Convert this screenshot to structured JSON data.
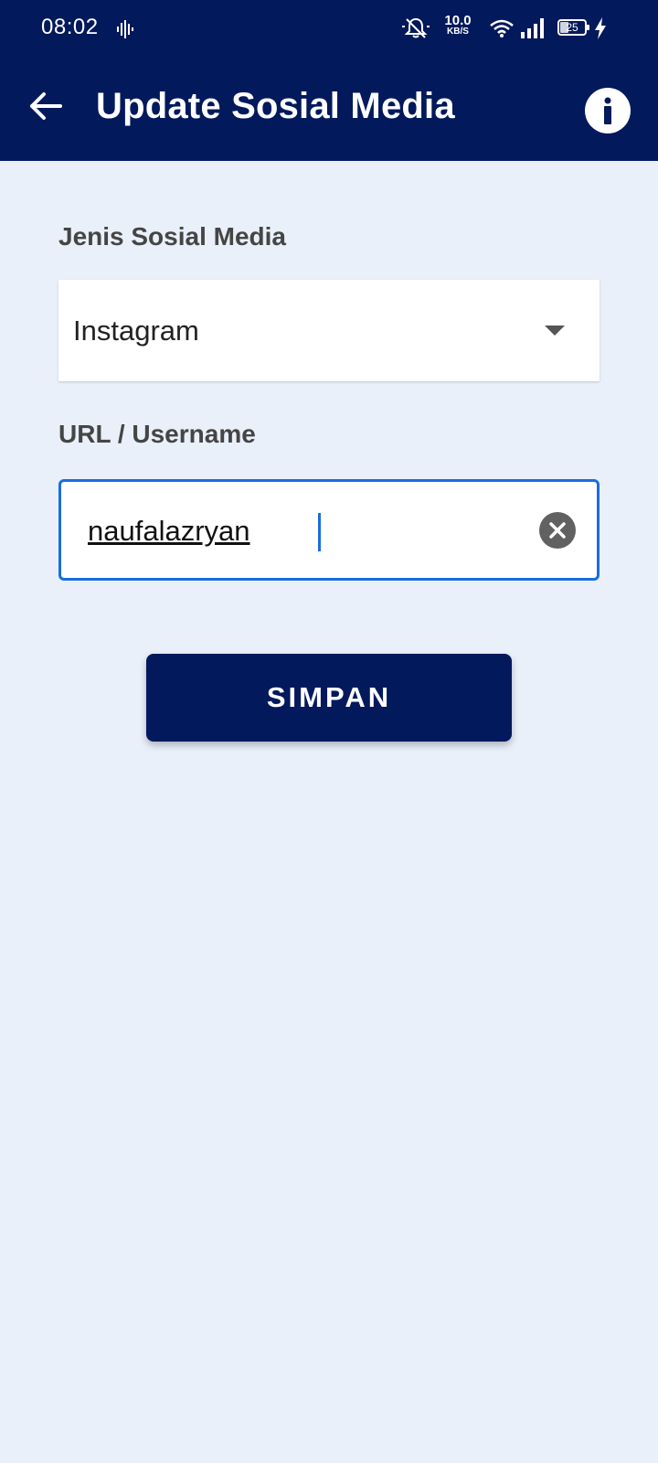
{
  "status_bar": {
    "time": "08:02",
    "speed_value": "10.0",
    "speed_unit": "KB/S",
    "battery": "25",
    "icons": [
      "voice-wave-icon",
      "mute-bell-icon",
      "wifi-icon",
      "signal-icon",
      "battery-icon",
      "charging-bolt-icon"
    ]
  },
  "app_bar": {
    "title": "Update Sosial Media",
    "back_icon": "arrow-left-icon",
    "info_icon": "info-icon"
  },
  "form": {
    "type_label": "Jenis Sosial Media",
    "type_value": "Instagram",
    "url_label": "URL / Username",
    "url_value": "naufalazryan",
    "clear_icon": "clear-circle-icon",
    "save_label": "SIMPAN"
  },
  "colors": {
    "primary": "#02195c",
    "background": "#e9f0fa",
    "focus": "#1a6ce0"
  }
}
